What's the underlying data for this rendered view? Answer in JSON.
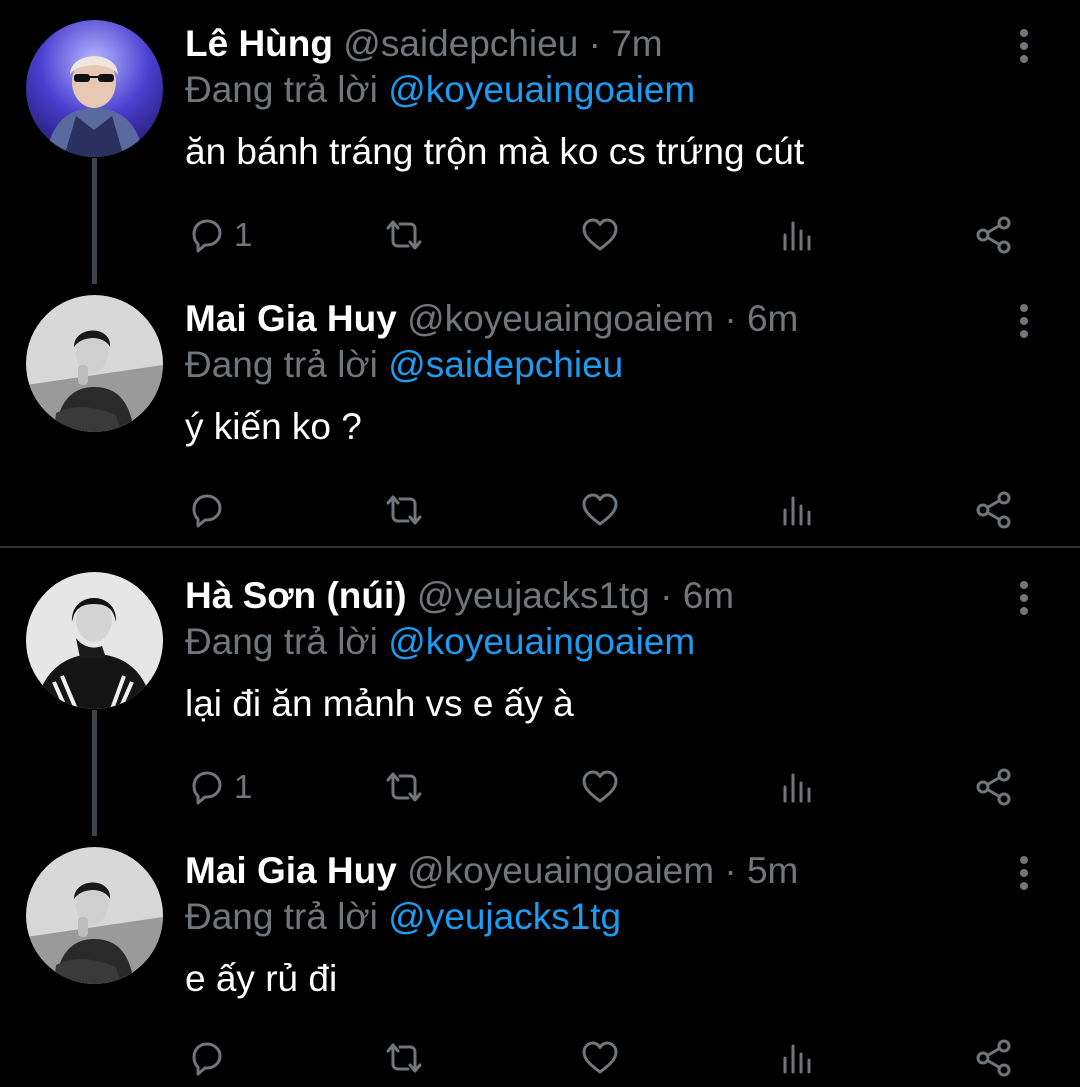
{
  "reply_prefix": "Đang trả lời",
  "colors": {
    "background": "#000000",
    "accent": "#1d9bf0",
    "muted": "#71767b",
    "text": "#ffffff",
    "thread_line": "#3d4349"
  },
  "icons": {
    "reply": "reply-icon",
    "retweet": "retweet-icon",
    "like": "heart-icon",
    "views": "analytics-icon",
    "share": "share-icon",
    "more": "more-vertical-icon"
  },
  "tweets": [
    {
      "name": "Lê Hùng",
      "handle": "@saidepchieu",
      "sep": "·",
      "time": "7m",
      "reply_to": "@koyeuaingoaiem",
      "text": "ăn bánh tráng trộn mà ko cs trứng cút",
      "reply_count": "1"
    },
    {
      "name": "Mai Gia Huy",
      "handle": "@koyeuaingoaiem",
      "sep": "·",
      "time": "6m",
      "reply_to": "@saidepchieu",
      "text": "ý kiến ko ?",
      "reply_count": ""
    },
    {
      "name": "Hà Sơn (núi)",
      "handle": "@yeujacks1tg",
      "sep": "·",
      "time": "6m",
      "reply_to": "@koyeuaingoaiem",
      "text": "lại đi ăn mảnh vs e ấy à",
      "reply_count": "1"
    },
    {
      "name": "Mai Gia Huy",
      "handle": "@koyeuaingoaiem",
      "sep": "·",
      "time": "5m",
      "reply_to": "@yeujacks1tg",
      "text": "e ấy rủ đi",
      "reply_count": ""
    }
  ]
}
